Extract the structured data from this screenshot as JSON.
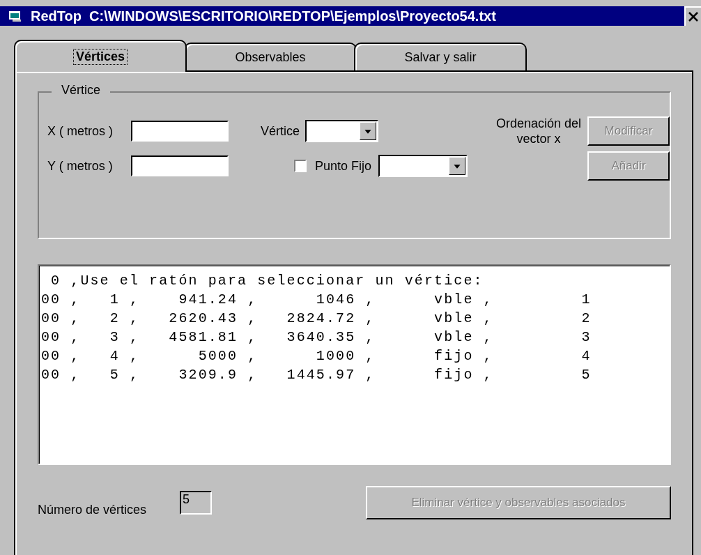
{
  "window": {
    "title": "RedTop  C:\\WINDOWS\\ESCRITORIO\\REDTOP\\Ejemplos\\Proyecto54.txt"
  },
  "tabs": [
    {
      "label": "Vértices",
      "selected": true
    },
    {
      "label": "Observables",
      "selected": false
    },
    {
      "label": "Salvar y salir",
      "selected": false
    }
  ],
  "group": {
    "title": "Vértice",
    "x_label": "X ( metros )",
    "y_label": "Y ( metros )",
    "vertex_label": "Vértice",
    "fixed_point": {
      "label": "Punto Fijo",
      "checked": false
    },
    "order_label": "Ordenación del vector x",
    "modify_button": {
      "label": "Modificar",
      "disabled": true
    },
    "add_button": {
      "label": "Añadir",
      "disabled": true
    }
  },
  "listing": [
    " 0 ,Use el ratón para seleccionar un vértice:",
    "00 ,   1 ,    941.24 ,      1046 ,      vble ,         1",
    "00 ,   2 ,   2620.43 ,   2824.72 ,      vble ,         2",
    "00 ,   3 ,   4581.81 ,   3640.35 ,      vble ,         3",
    "00 ,   4 ,      5000 ,      1000 ,      fijo ,         4",
    "00 ,   5 ,    3209.9 ,   1445.97 ,      fijo ,         5"
  ],
  "footer": {
    "count_label": "Número de vértices",
    "count_value": "5",
    "delete_button": {
      "label": "Eliminar vértice y observables asociados",
      "disabled": true
    }
  }
}
